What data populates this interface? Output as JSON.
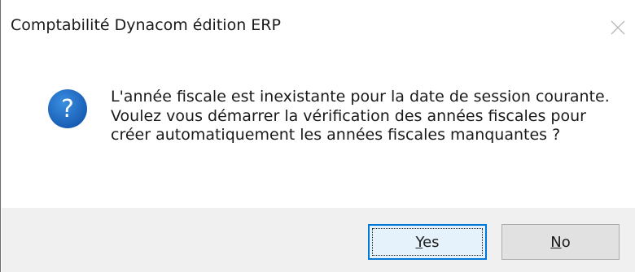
{
  "dialog": {
    "title": "Comptabilité Dynacom édition ERP",
    "close_icon": "close-icon",
    "icon": "question-icon",
    "icon_color": "#1f6fc5",
    "message": "L'année fiscale est inexistante pour la date de session courante. Voulez vous démarrer la vérification des années fiscales pour créer automatiquement les années fiscales manquantes ?",
    "accent_color": "#0078d7"
  },
  "buttons": {
    "yes": {
      "access_key": "Y",
      "rest": "es"
    },
    "no": {
      "access_key": "N",
      "rest": "o"
    }
  }
}
